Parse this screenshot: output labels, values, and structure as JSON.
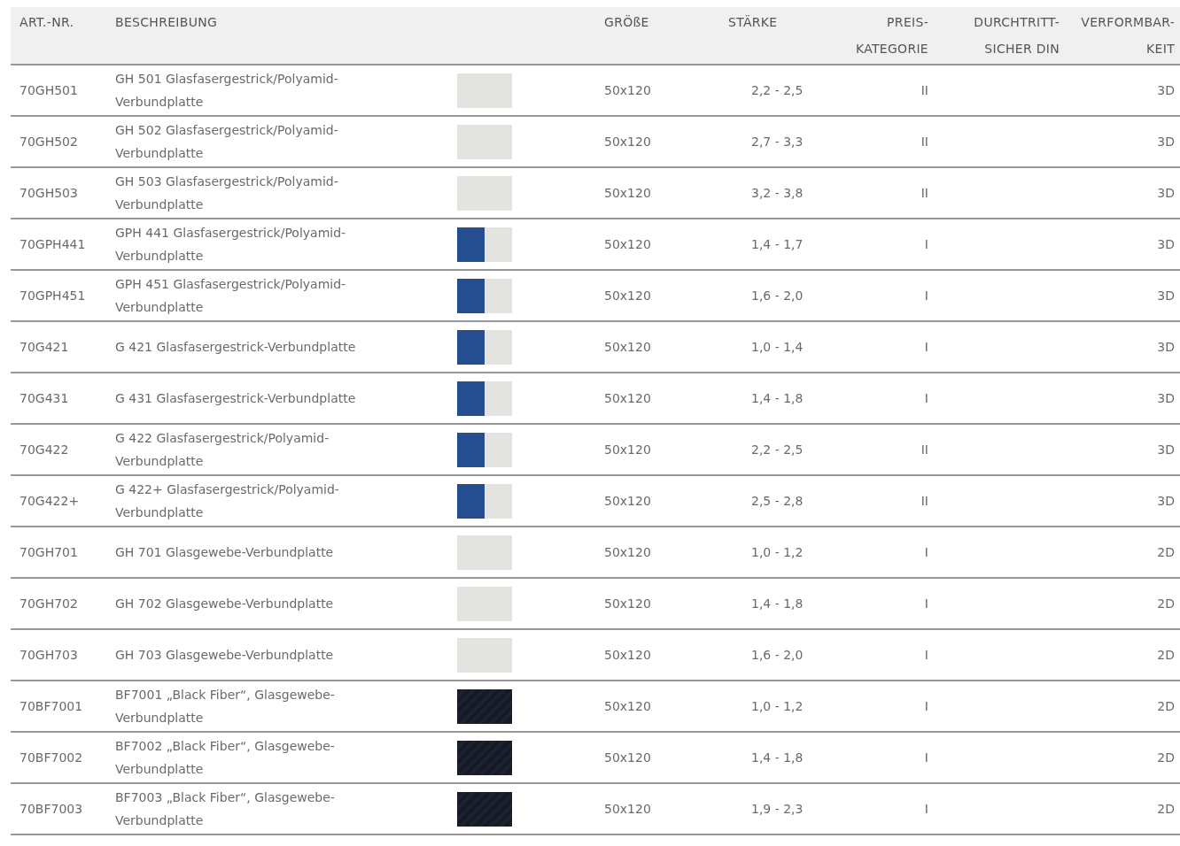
{
  "table": {
    "columns": [
      "ART.-NR.",
      "BESCHREIBUNG",
      "",
      "GRÖßE",
      "STÄRKE",
      "PREIS-KATEGORIE",
      "DURCHTRITT-SICHER DIN",
      "VERFORMBAR-KEIT"
    ],
    "rows": [
      {
        "art": "70GH501",
        "description": "GH 501 Glasfasergestrick/Polyamid-Verbundplatte",
        "kind": "light",
        "size": "50x120",
        "thickness": "2,2 - 2,5",
        "price": "II",
        "form": "3D"
      },
      {
        "art": "70GH502",
        "description": "GH 502 Glasfasergestrick/Polyamid-Verbundplatte",
        "kind": "light",
        "size": "50x120",
        "thickness": "2,7 - 3,3",
        "price": "II",
        "form": "3D"
      },
      {
        "art": "70GH503",
        "description": "GH 503 Glasfasergestrick/Polyamid-Verbundplatte",
        "kind": "light",
        "size": "50x120",
        "thickness": "3,2 - 3,8",
        "price": "II",
        "form": "3D"
      },
      {
        "art": "70GPH441",
        "description": "GPH 441 Glasfasergestrick/Polyamid-Verbundplatte",
        "kind": "blue",
        "size": "50x120",
        "thickness": "1,4 - 1,7",
        "price": "I",
        "form": "3D"
      },
      {
        "art": "70GPH451",
        "description": "GPH 451 Glasfasergestrick/Polyamid-Verbundplatte",
        "kind": "blue",
        "size": "50x120",
        "thickness": "1,6 - 2,0",
        "price": "I",
        "form": "3D"
      },
      {
        "art": "70G421",
        "description": "G 421 Glasfasergestrick-Verbundplatte",
        "kind": "blue",
        "size": "50x120",
        "thickness": "1,0 - 1,4",
        "price": "I",
        "form": "3D"
      },
      {
        "art": "70G431",
        "description": "G 431 Glasfasergestrick-Verbundplatte",
        "kind": "blue",
        "size": "50x120",
        "thickness": "1,4 - 1,8",
        "price": "I",
        "form": "3D"
      },
      {
        "art": "70G422",
        "description": "G 422  Glasfasergestrick/Polyamid-Verbundplatte",
        "kind": "blue",
        "size": "50x120",
        "thickness": "2,2 - 2,5",
        "price": "II",
        "form": "3D"
      },
      {
        "art": "70G422+",
        "description": "G 422+  Glasfasergestrick/Polyamid-Verbundplatte",
        "kind": "blue",
        "size": "50x120",
        "thickness": "2,5 - 2,8",
        "price": "II",
        "form": "3D"
      },
      {
        "art": "70GH701",
        "description": "GH 701 Glasgewebe-Verbundplatte",
        "kind": "light",
        "size": "50x120",
        "thickness": "1,0 - 1,2",
        "price": "I",
        "form": "2D"
      },
      {
        "art": "70GH702",
        "description": "GH 702 Glasgewebe-Verbundplatte",
        "kind": "light",
        "size": "50x120",
        "thickness": "1,4 - 1,8",
        "price": "I",
        "form": "2D"
      },
      {
        "art": "70GH703",
        "description": "GH 703 Glasgewebe-Verbundplatte",
        "kind": "light",
        "size": "50x120",
        "thickness": "1,6 - 2,0",
        "price": "I",
        "form": "2D"
      },
      {
        "art": "70BF7001",
        "description": "BF7001 „Black Fiber“, Glasgewebe-Verbundplatte",
        "kind": "dark",
        "size": "50x120",
        "thickness": "1,0 - 1,2",
        "price": "I",
        "form": "2D"
      },
      {
        "art": "70BF7002",
        "description": "BF7002 „Black Fiber“, Glasgewebe-Verbundplatte",
        "kind": "dark",
        "size": "50x120",
        "thickness": "1,4 - 1,8",
        "price": "I",
        "form": "2D"
      },
      {
        "art": "70BF7003",
        "description": "BF7003 „Black Fiber“, Glasgewebe-Verbundplatte",
        "kind": "dark",
        "size": "50x120",
        "thickness": "1,9 - 2,3",
        "price": "I",
        "form": "2D"
      }
    ]
  }
}
